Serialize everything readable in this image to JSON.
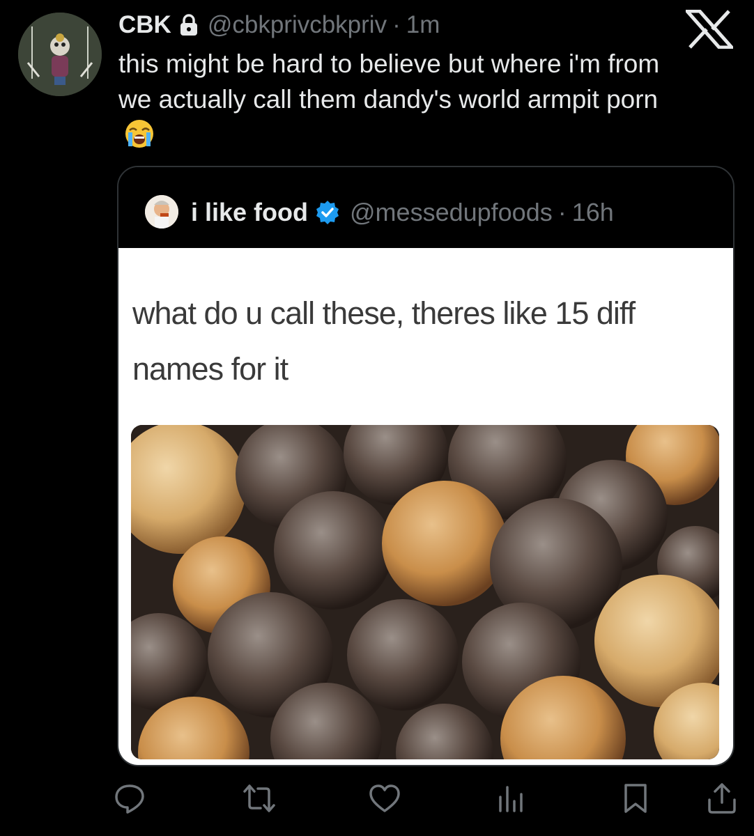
{
  "tweet": {
    "author_name": "CBK",
    "handle": "@cbkprivcbkpriv",
    "separator": "·",
    "time": "1m",
    "text": "this might be hard to believe but where i'm from we actually call them dandy's world armpit porn",
    "emoji": "loudly-crying-face"
  },
  "quoted_tweet": {
    "author_name": "i like food",
    "verified": true,
    "handle": "@messedupfoods",
    "separator": "·",
    "time": "16h",
    "meme_text": "what do u call these, theres like 15 diff names for it",
    "image_subject": "donut holes"
  },
  "actions": [
    {
      "name": "reply-icon",
      "count": ""
    },
    {
      "name": "retweet-icon",
      "count": ""
    },
    {
      "name": "like-icon",
      "count": ""
    },
    {
      "name": "views-icon",
      "count": ""
    },
    {
      "name": "bookmark-icon",
      "count": ""
    },
    {
      "name": "share-icon",
      "count": ""
    }
  ],
  "colors": {
    "background": "#000000",
    "text_primary": "#e7e9ea",
    "text_secondary": "#71767b",
    "border": "#2f3336",
    "verified_blue": "#1d9bf0"
  }
}
